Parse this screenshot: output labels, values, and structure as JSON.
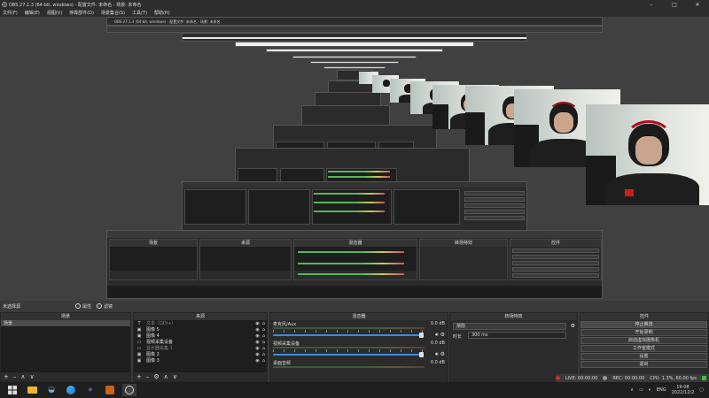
{
  "window": {
    "title": "OBS 27.1.3 (64-bit, windows) - 配置文件: 未命名 - 场景: 未命名",
    "controls": [
      "–",
      "□",
      "✕"
    ]
  },
  "menu": [
    "文件(F)",
    "编辑(E)",
    "视图(V)",
    "停靠部件(D)",
    "场景集合(S)",
    "工具(T)",
    "帮助(H)"
  ],
  "source_toolbar": {
    "no_source": "未选择源",
    "properties": "属性",
    "filters": "滤镜"
  },
  "docks": {
    "scenes": {
      "title": "场景",
      "items": [
        "场景"
      ]
    },
    "sources": {
      "title": "来源",
      "items": [
        {
          "icon": "T",
          "name": "文本（GDI+）",
          "dim": true
        },
        {
          "icon": "▣",
          "name": "图像 5",
          "dim": false
        },
        {
          "icon": "▣",
          "name": "图像 4",
          "dim": false
        },
        {
          "icon": "▭",
          "name": "视频采集设备",
          "dim": false
        },
        {
          "icon": "▭",
          "name": "显示器采集 1",
          "dim": true
        },
        {
          "icon": "▣",
          "name": "图像 2",
          "dim": false
        },
        {
          "icon": "▣",
          "name": "图像 3",
          "dim": false
        }
      ]
    },
    "mixer": {
      "title": "混音器",
      "channels": [
        {
          "name": "麦克风/Aux",
          "db": "0.0 dB"
        },
        {
          "name": "视频采集设备",
          "db": "0.0 dB"
        },
        {
          "name": "桌面音频",
          "db": "0.0 dB"
        }
      ]
    },
    "transitions": {
      "title": "转场特效",
      "selected": "渐隐",
      "duration_label": "时长",
      "duration": "300 ms"
    },
    "controls": {
      "title": "控件",
      "buttons": [
        "停止推流",
        "开始录制",
        "启动虚拟摄像机",
        "工作室模式",
        "设置",
        "退出"
      ]
    }
  },
  "status": {
    "live": "LIVE: 00:00:00",
    "rec": "REC: 00:00:00",
    "cpu": "CPU: 1.3%, 60.00 fps"
  },
  "tray": {
    "lang": "ENG",
    "time": "19:08",
    "date": "2022/12/2"
  },
  "nested": {
    "l1_title": "OBS 27.1.3 (64-bit, windows) - 配置文件: 未命名 - 场景: 未命名",
    "l1_controls": [
      "属性",
      "滤镜"
    ],
    "l1_scenes": "场景",
    "l1_sources": "来源",
    "l1_mixer": "混音器",
    "l1_trans": "转场特效",
    "l1_ctrl": "控件",
    "l1_btns": [
      "停止推流",
      "开始录制",
      "启动虚拟摄像机",
      "工作室模式",
      "设置",
      "退出"
    ],
    "l1_srcs": [
      "文本（GDI+）",
      "图像 5",
      "图像 4",
      "视频采集设备",
      "显示器采集 1",
      "图像 2",
      "图像 3"
    ]
  },
  "colors": {
    "bg": "#3a3a3a",
    "panel": "#1e1e1e",
    "accent": "#3c8adf"
  }
}
